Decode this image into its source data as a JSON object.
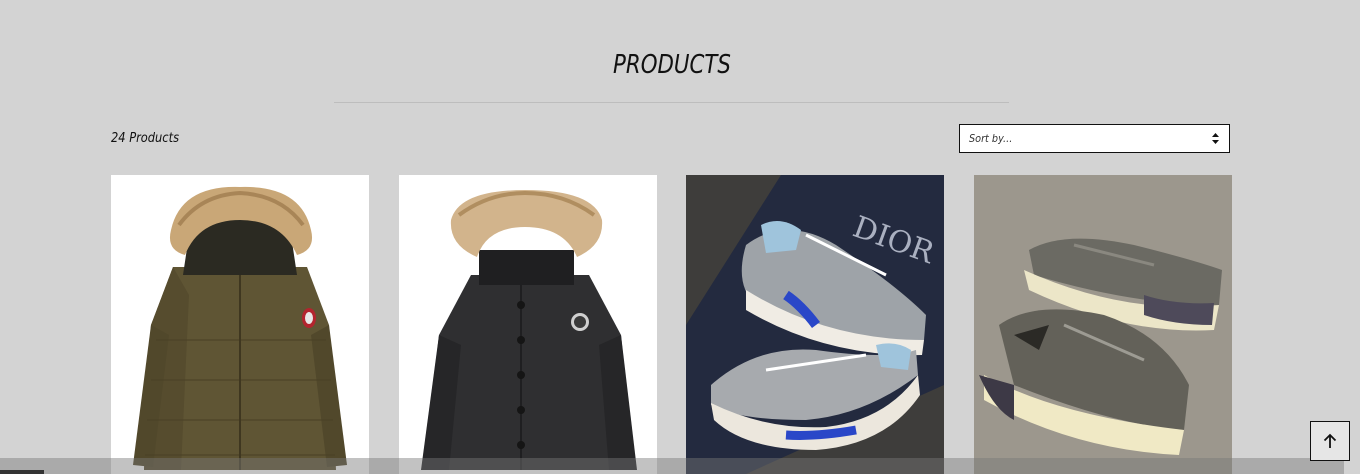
{
  "page": {
    "title": "PRODUCTS"
  },
  "toolbar": {
    "product_count": "24 Products",
    "sort_placeholder": "Sort by..."
  },
  "products": [
    {
      "image": "olive-parka-with-fur-hood"
    },
    {
      "image": "black-parka-with-fur-hood"
    },
    {
      "image": "grey-blue-sneakers-on-box"
    },
    {
      "image": "grey-knit-sneakers"
    }
  ],
  "icons": {
    "sort": "sort-arrows-icon",
    "back_to_top": "arrow-up-icon"
  },
  "colors": {
    "background": "#d3d3d3",
    "text": "#111111",
    "rule": "#bdbdbd"
  }
}
